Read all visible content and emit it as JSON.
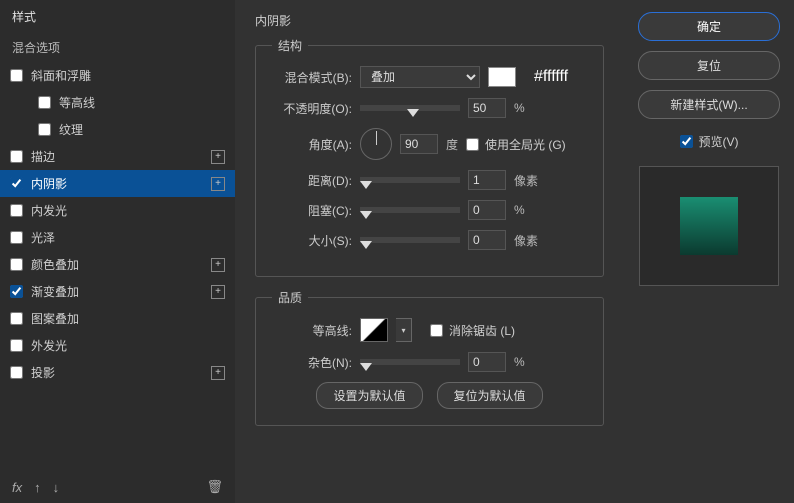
{
  "sidebar": {
    "title": "样式",
    "subtitle": "混合选项",
    "items": [
      {
        "label": "斜面和浮雕",
        "checked": false,
        "add": false,
        "sub": false
      },
      {
        "label": "等高线",
        "checked": false,
        "add": false,
        "sub": true
      },
      {
        "label": "纹理",
        "checked": false,
        "add": false,
        "sub": true
      },
      {
        "label": "描边",
        "checked": false,
        "add": true,
        "sub": false
      },
      {
        "label": "内阴影",
        "checked": true,
        "add": true,
        "sub": false,
        "selected": true
      },
      {
        "label": "内发光",
        "checked": false,
        "add": false,
        "sub": false
      },
      {
        "label": "光泽",
        "checked": false,
        "add": false,
        "sub": false
      },
      {
        "label": "颜色叠加",
        "checked": false,
        "add": true,
        "sub": false
      },
      {
        "label": "渐变叠加",
        "checked": true,
        "add": true,
        "sub": false
      },
      {
        "label": "图案叠加",
        "checked": false,
        "add": false,
        "sub": false
      },
      {
        "label": "外发光",
        "checked": false,
        "add": false,
        "sub": false
      },
      {
        "label": "投影",
        "checked": false,
        "add": true,
        "sub": false
      }
    ],
    "footer_fx": "fx"
  },
  "panel": {
    "title": "内阴影",
    "group_structure": "结构",
    "group_quality": "品质",
    "blend_mode_label": "混合模式(B):",
    "blend_mode_value": "叠加",
    "color_hex": "#ffffff",
    "opacity_label": "不透明度(O):",
    "opacity_value": "50",
    "opacity_unit": "%",
    "angle_label": "角度(A):",
    "angle_value": "90",
    "angle_unit": "度",
    "global_light_label": "使用全局光 (G)",
    "global_light_checked": false,
    "distance_label": "距离(D):",
    "distance_value": "1",
    "px_unit": "像素",
    "choke_label": "阻塞(C):",
    "choke_value": "0",
    "pct_unit": "%",
    "size_label": "大小(S):",
    "size_value": "0",
    "contour_label": "等高线:",
    "antialias_label": "消除锯齿 (L)",
    "antialias_checked": false,
    "noise_label": "杂色(N):",
    "noise_value": "0",
    "btn_default": "设置为默认值",
    "btn_reset": "复位为默认值"
  },
  "right": {
    "ok": "确定",
    "cancel": "复位",
    "new_style": "新建样式(W)...",
    "preview_label": "预览(V)",
    "preview_checked": true
  }
}
